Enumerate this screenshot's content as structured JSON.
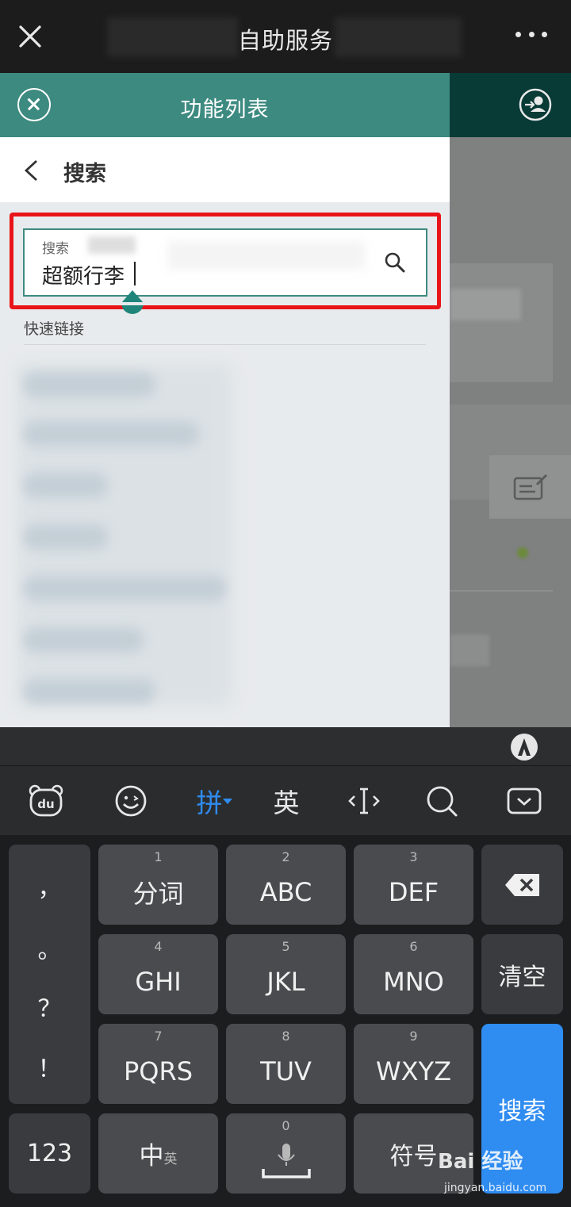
{
  "navbar": {
    "title": "自助服务"
  },
  "drawer": {
    "header_title": "功能列表",
    "breadcrumb_label": "搜索",
    "search": {
      "label": "搜索",
      "value": "超额行李"
    },
    "quick_links_label": "快速链接"
  },
  "keyboard": {
    "tools": [
      "du",
      "emoji",
      "拼",
      "英",
      "cursor",
      "search",
      "hide"
    ],
    "punctuation": [
      "，",
      "。",
      "？",
      "！"
    ],
    "keys": {
      "k1": {
        "num": "1",
        "label": "分词"
      },
      "k2": {
        "num": "2",
        "label": "ABC"
      },
      "k3": {
        "num": "3",
        "label": "DEF"
      },
      "k4": {
        "num": "4",
        "label": "GHI"
      },
      "k5": {
        "num": "5",
        "label": "JKL"
      },
      "k6": {
        "num": "6",
        "label": "MNO"
      },
      "k7": {
        "num": "7",
        "label": "PQRS"
      },
      "k8": {
        "num": "8",
        "label": "TUV"
      },
      "k9": {
        "num": "9",
        "label": "WXYZ"
      },
      "k0": {
        "num": "0"
      },
      "clear": "清空",
      "search": "搜索",
      "num_mode": "123",
      "lang_main": "中",
      "lang_sub": "英",
      "symbols": "符号"
    }
  },
  "watermark": {
    "brand": "Bai 经验",
    "url": "jingyan.baidu.com"
  },
  "colors": {
    "primary": "#3d8a80",
    "highlight": "#e8141a",
    "keyboard_accent": "#2f8cf0"
  }
}
